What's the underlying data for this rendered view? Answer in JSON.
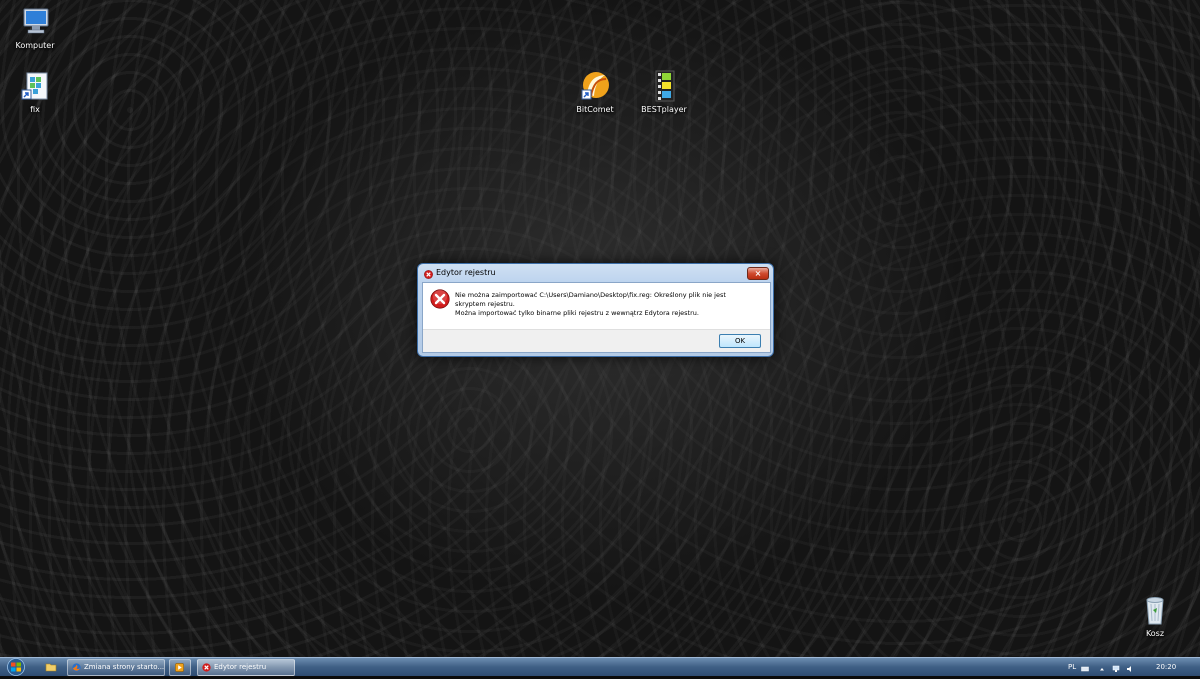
{
  "desktop": {
    "icons": [
      {
        "id": "computer",
        "label": "Komputer",
        "icon": "computer-icon"
      },
      {
        "id": "fix",
        "label": "fix",
        "icon": "registry-file-icon"
      },
      {
        "id": "bitcomet",
        "label": "BitComet",
        "icon": "bitcomet-icon"
      },
      {
        "id": "bestplayer",
        "label": "BESTplayer",
        "icon": "video-player-icon"
      },
      {
        "id": "recycle",
        "label": "Kosz",
        "icon": "recycle-bin-icon"
      }
    ]
  },
  "dialog": {
    "title": "Edytor rejestru",
    "close_label": "×",
    "message_line1": "Nie można zaimportować C:\\Users\\Damiano\\Desktop\\fix.reg: Określony plik nie jest skryptem rejestru.",
    "message_line2": "Można importować tylko binarne pliki rejestru z wewnątrz Edytora rejestru.",
    "ok_label": "OK",
    "icon": "error-icon"
  },
  "taskbar": {
    "start_icon": "windows-start-icon",
    "quick_launch": [
      "folder-icon"
    ],
    "tasks": [
      {
        "label": "Zmiana strony starto...",
        "icon": "firefox-icon"
      },
      {
        "label": "",
        "icon": "media-player-icon"
      },
      {
        "label": "Edytor rejestru",
        "icon": "error-icon",
        "active": true
      }
    ],
    "tray": {
      "language": "PL",
      "clock": "20:20"
    }
  },
  "colors": {
    "error_red": "#d11c1c",
    "taskbar": "#3f5f85",
    "dialog_frame": "#bcd3ee"
  }
}
